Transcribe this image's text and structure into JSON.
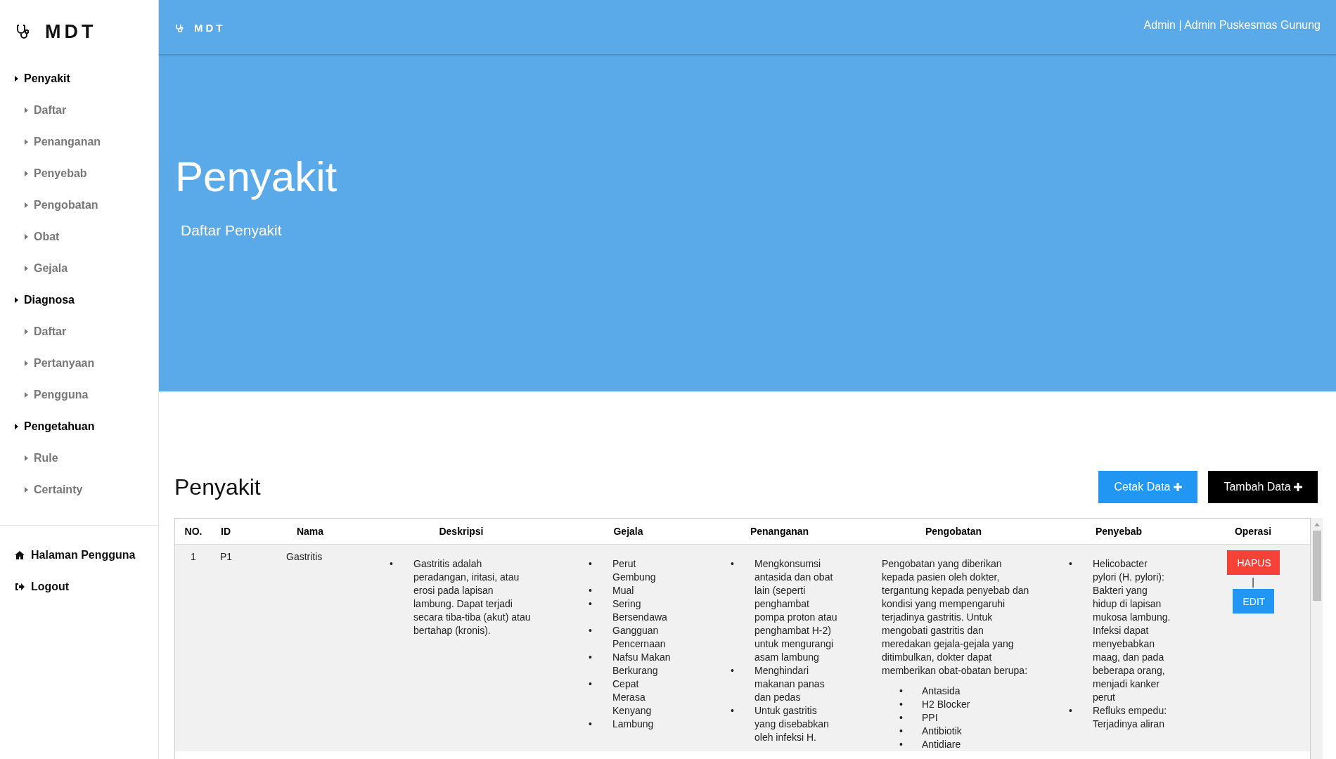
{
  "brand": {
    "title": "MDT"
  },
  "sidebar": {
    "items": [
      {
        "label": "Penyakit",
        "children": [
          {
            "label": "Daftar"
          },
          {
            "label": "Penanganan"
          },
          {
            "label": "Penyebab"
          },
          {
            "label": "Pengobatan"
          },
          {
            "label": "Obat"
          },
          {
            "label": "Gejala"
          }
        ]
      },
      {
        "label": "Diagnosa",
        "children": [
          {
            "label": "Daftar"
          },
          {
            "label": "Pertanyaan"
          },
          {
            "label": "Pengguna"
          }
        ]
      },
      {
        "label": "Pengetahuan",
        "children": [
          {
            "label": "Rule"
          },
          {
            "label": "Certainty"
          }
        ]
      }
    ],
    "footer_items": [
      {
        "label": "Halaman Pengguna",
        "kind": "home"
      },
      {
        "label": "Logout",
        "kind": "logout"
      }
    ]
  },
  "topbar": {
    "brand": "MDT",
    "user": "Admin | Admin Puskesmas Gunung"
  },
  "hero": {
    "title": "Penyakit",
    "subtitle": "Daftar Penyakit"
  },
  "section": {
    "title": "Penyakit",
    "buttons": [
      {
        "label": "Cetak Data",
        "kind": "print"
      },
      {
        "label": "Tambah Data",
        "kind": "add"
      }
    ]
  },
  "table": {
    "columns": [
      "NO.",
      "ID",
      "Nama",
      "Deskripsi",
      "Gejala",
      "Penanganan",
      "Pengobatan",
      "Penyebab",
      "Operasi"
    ],
    "rows": [
      {
        "no": "1",
        "id": "P1",
        "nama": "Gastritis",
        "deskripsi": [
          "Gastritis adalah peradangan, iritasi, atau erosi pada lapisan lambung. Dapat terjadi secara tiba-tiba (akut) atau bertahap (kronis)."
        ],
        "gejala": [
          "Perut Gembung",
          "Mual",
          "Sering Bersendawa",
          "Gangguan Pencernaan",
          "Nafsu Makan Berkurang",
          "Cepat Merasa Kenyang",
          "Lambung"
        ],
        "penanganan": [
          "Mengkonsumsi antasida dan obat lain (seperti penghambat pompa proton atau penghambat H-2) untuk mengurangi asam lambung",
          "Menghindari makanan panas dan pedas",
          "Untuk gastritis yang disebabkan oleh infeksi H."
        ],
        "pengobatan": {
          "text": "Pengobatan yang diberikan kepada pasien oleh dokter, tergantung kepada penyebab dan kondisi yang mempengaruhi terjadinya gastritis. Untuk mengobati gastritis dan meredakan gejala-gejala yang ditimbulkan, dokter dapat memberikan obat-obatan berupa:",
          "items": [
            "Antasida",
            "H2 Blocker",
            "PPI",
            "Antibiotik",
            "Antidiare"
          ]
        },
        "penyebab": [
          "Helicobacter pylori (H. pylori): Bakteri yang hidup di lapisan mukosa lambung. Infeksi dapat menyebabkan maag, dan pada beberapa orang, menjadi kanker perut",
          "Refluks empedu: Terjadinya aliran"
        ],
        "actions": [
          {
            "label": "HAPUS",
            "kind": "delete"
          },
          {
            "label": "EDIT",
            "kind": "edit"
          }
        ],
        "separator": "|",
        "bullet": "•"
      }
    ]
  }
}
